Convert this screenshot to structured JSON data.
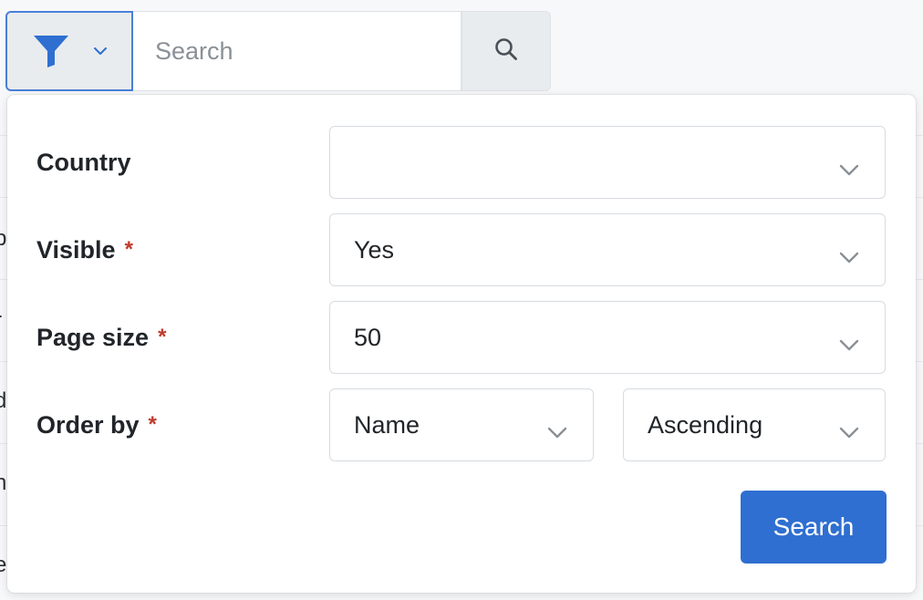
{
  "search": {
    "placeholder": "Search",
    "value": ""
  },
  "filters": {
    "country": {
      "label": "Country",
      "value": "",
      "required": false
    },
    "visible": {
      "label": "Visible",
      "value": "Yes",
      "required": true
    },
    "page_size": {
      "label": "Page size",
      "value": "50",
      "required": true
    },
    "order_by": {
      "label": "Order by",
      "field": "Name",
      "direction": "Ascending",
      "required": true
    },
    "required_marker": "*"
  },
  "submit_label": "Search",
  "background_row_chars": [
    "p",
    "r",
    "d",
    "n",
    "e"
  ],
  "colors": {
    "accent": "#2f6fd1",
    "required": "#c0392b",
    "filter_icon": "#2f6fd1"
  }
}
